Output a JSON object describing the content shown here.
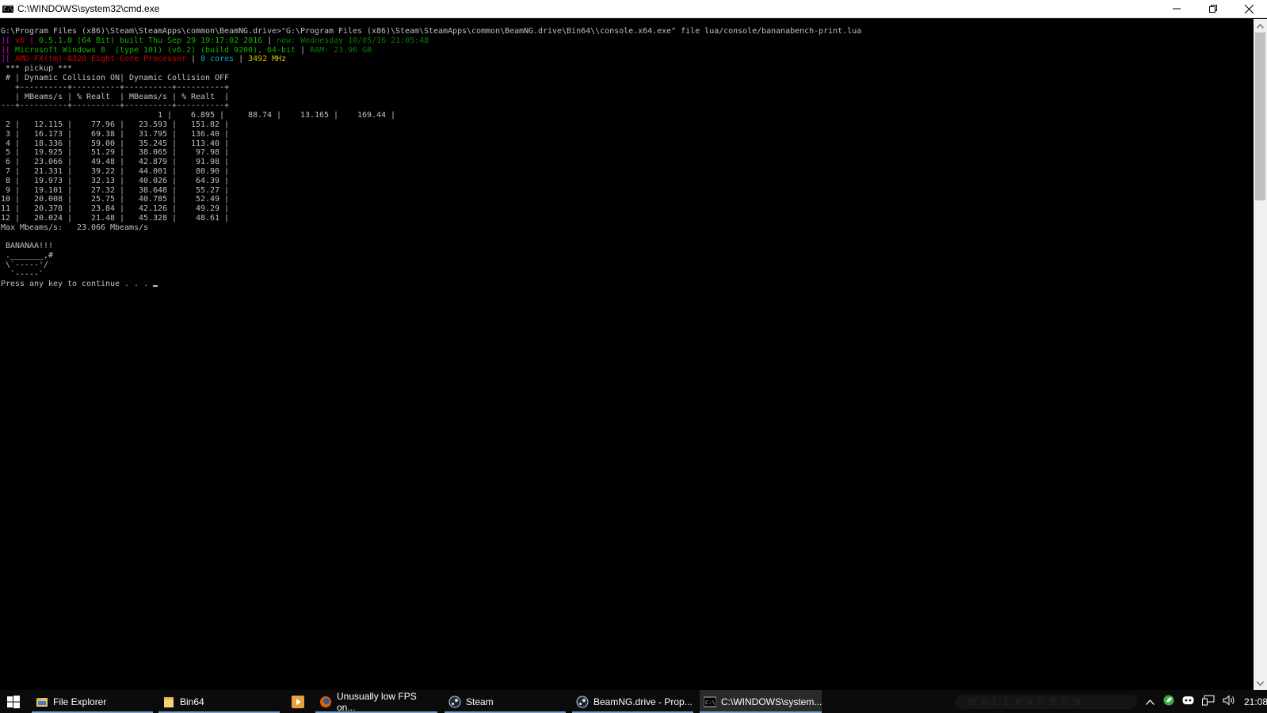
{
  "window": {
    "title": "C:\\WINDOWS\\system32\\cmd.exe",
    "app_icon_label": "C:\\"
  },
  "console": {
    "lines": [
      [
        {
          "t": "G:\\Program Files (x86)\\Steam\\SteamApps\\common\\BeamNG.drive>\"G:\\Program Files (x86)\\Steam\\SteamApps\\common\\BeamNG.drive\\Bin64\\\\console.x64.exe\" file lua/console/bananabench-print.lua",
          "c": "white"
        }
      ],
      [
        {
          "t": "][ ",
          "c": "magenta"
        },
        {
          "t": "v6",
          "c": "red"
        },
        {
          "t": " | ",
          "c": "magenta"
        },
        {
          "t": "0.5.1.0 (64 Bit) built Thu Sep 29 19:17:02 2016",
          "c": "green"
        },
        {
          "t": " | ",
          "c": "white"
        },
        {
          "t": "now: Wednesday 10/05/16 21:05:48",
          "c": "dgreen"
        }
      ],
      [
        {
          "t": "][ ",
          "c": "magenta"
        },
        {
          "t": "Microsoft Windows 8  (type 101) (v6.2) (build 9200), 64-bit",
          "c": "green"
        },
        {
          "t": " | ",
          "c": "white"
        },
        {
          "t": "RAM: 23.96 GB",
          "c": "dgreen"
        }
      ],
      [
        {
          "t": "][ ",
          "c": "magenta"
        },
        {
          "t": "AMD FX(tm)-8320 Eight-Core Processor",
          "c": "red"
        },
        {
          "t": " | ",
          "c": "white"
        },
        {
          "t": "8 cores",
          "c": "cyan"
        },
        {
          "t": " | ",
          "c": "white"
        },
        {
          "t": "3492 MHz",
          "c": "yellow"
        }
      ],
      [
        {
          "t": " *** pickup ***",
          "c": "white"
        }
      ],
      [
        {
          "t": " # | Dynamic Collision ON| Dynamic Collision OFF",
          "c": "white"
        }
      ],
      [
        {
          "t": "   +----------+----------+----------+----------+",
          "c": "white"
        }
      ],
      [
        {
          "t": "   | MBeams/s | % Realt  | MBeams/s | % Realt  |",
          "c": "white"
        }
      ],
      [
        {
          "t": "---+----------+----------+----------+----------+",
          "c": "white"
        }
      ],
      [
        {
          "t": "                                 1 |    6.895 |     88.74 |    13.165 |    169.44 |",
          "c": "white"
        }
      ],
      [
        {
          "t": " 2 |   12.115 |    77.96 |   23.593 |   151.82 |",
          "c": "white"
        }
      ],
      [
        {
          "t": " 3 |   16.173 |    69.38 |   31.795 |   136.40 |",
          "c": "white"
        }
      ],
      [
        {
          "t": " 4 |   18.336 |    59.00 |   35.245 |   113.40 |",
          "c": "white"
        }
      ],
      [
        {
          "t": " 5 |   19.925 |    51.29 |   38.065 |    97.98 |",
          "c": "white"
        }
      ],
      [
        {
          "t": " 6 |   23.066 |    49.48 |   42.879 |    91.98 |",
          "c": "white"
        }
      ],
      [
        {
          "t": " 7 |   21.331 |    39.22 |   44.001 |    80.90 |",
          "c": "white"
        }
      ],
      [
        {
          "t": " 8 |   19.973 |    32.13 |   40.026 |    64.39 |",
          "c": "white"
        }
      ],
      [
        {
          "t": " 9 |   19.101 |    27.32 |   38.648 |    55.27 |",
          "c": "white"
        }
      ],
      [
        {
          "t": "10 |   20.008 |    25.75 |   40.785 |    52.49 |",
          "c": "white"
        }
      ],
      [
        {
          "t": "11 |   20.378 |    23.84 |   42.126 |    49.29 |",
          "c": "white"
        }
      ],
      [
        {
          "t": "12 |   20.024 |    21.48 |   45.328 |    48.61 |",
          "c": "white"
        }
      ],
      [
        {
          "t": "Max Mbeams/s:   23.066 Mbeams/s",
          "c": "white"
        }
      ],
      [
        {
          "t": "",
          "c": "white"
        }
      ],
      [
        {
          "t": " BANANAA!!!",
          "c": "white"
        }
      ],
      [
        {
          "t": " ._______,#",
          "c": "white"
        }
      ],
      [
        {
          "t": " \\`-----'/",
          "c": "white"
        }
      ],
      [
        {
          "t": "  `-----`",
          "c": "white"
        }
      ],
      [
        {
          "t": "Press any key to continue . . . ",
          "c": "white"
        }
      ]
    ],
    "colors": {
      "white": "#c0c0c0",
      "magenta": "#c000c0",
      "green": "#13b300",
      "dgreen": "#0a7a0a",
      "red": "#d00000",
      "cyan": "#00a8c8",
      "yellow": "#c8c800"
    }
  },
  "taskbar": {
    "items": [
      {
        "label": "File Explorer",
        "icon": "file-explorer-icon"
      },
      {
        "label": "Bin64",
        "icon": "folder-icon"
      },
      {
        "label": "",
        "icon": "media-player-icon"
      },
      {
        "label": "Unusually low FPS on...",
        "icon": "firefox-icon"
      },
      {
        "label": "Steam",
        "icon": "steam-icon"
      },
      {
        "label": "BeamNG.drive - Prop...",
        "icon": "steam-icon"
      },
      {
        "label": "C:\\WINDOWS\\system...",
        "icon": "cmd-icon"
      }
    ],
    "watermark": "WALLPAPERS",
    "clock": "21:08",
    "accent": "#7a9cc6"
  }
}
